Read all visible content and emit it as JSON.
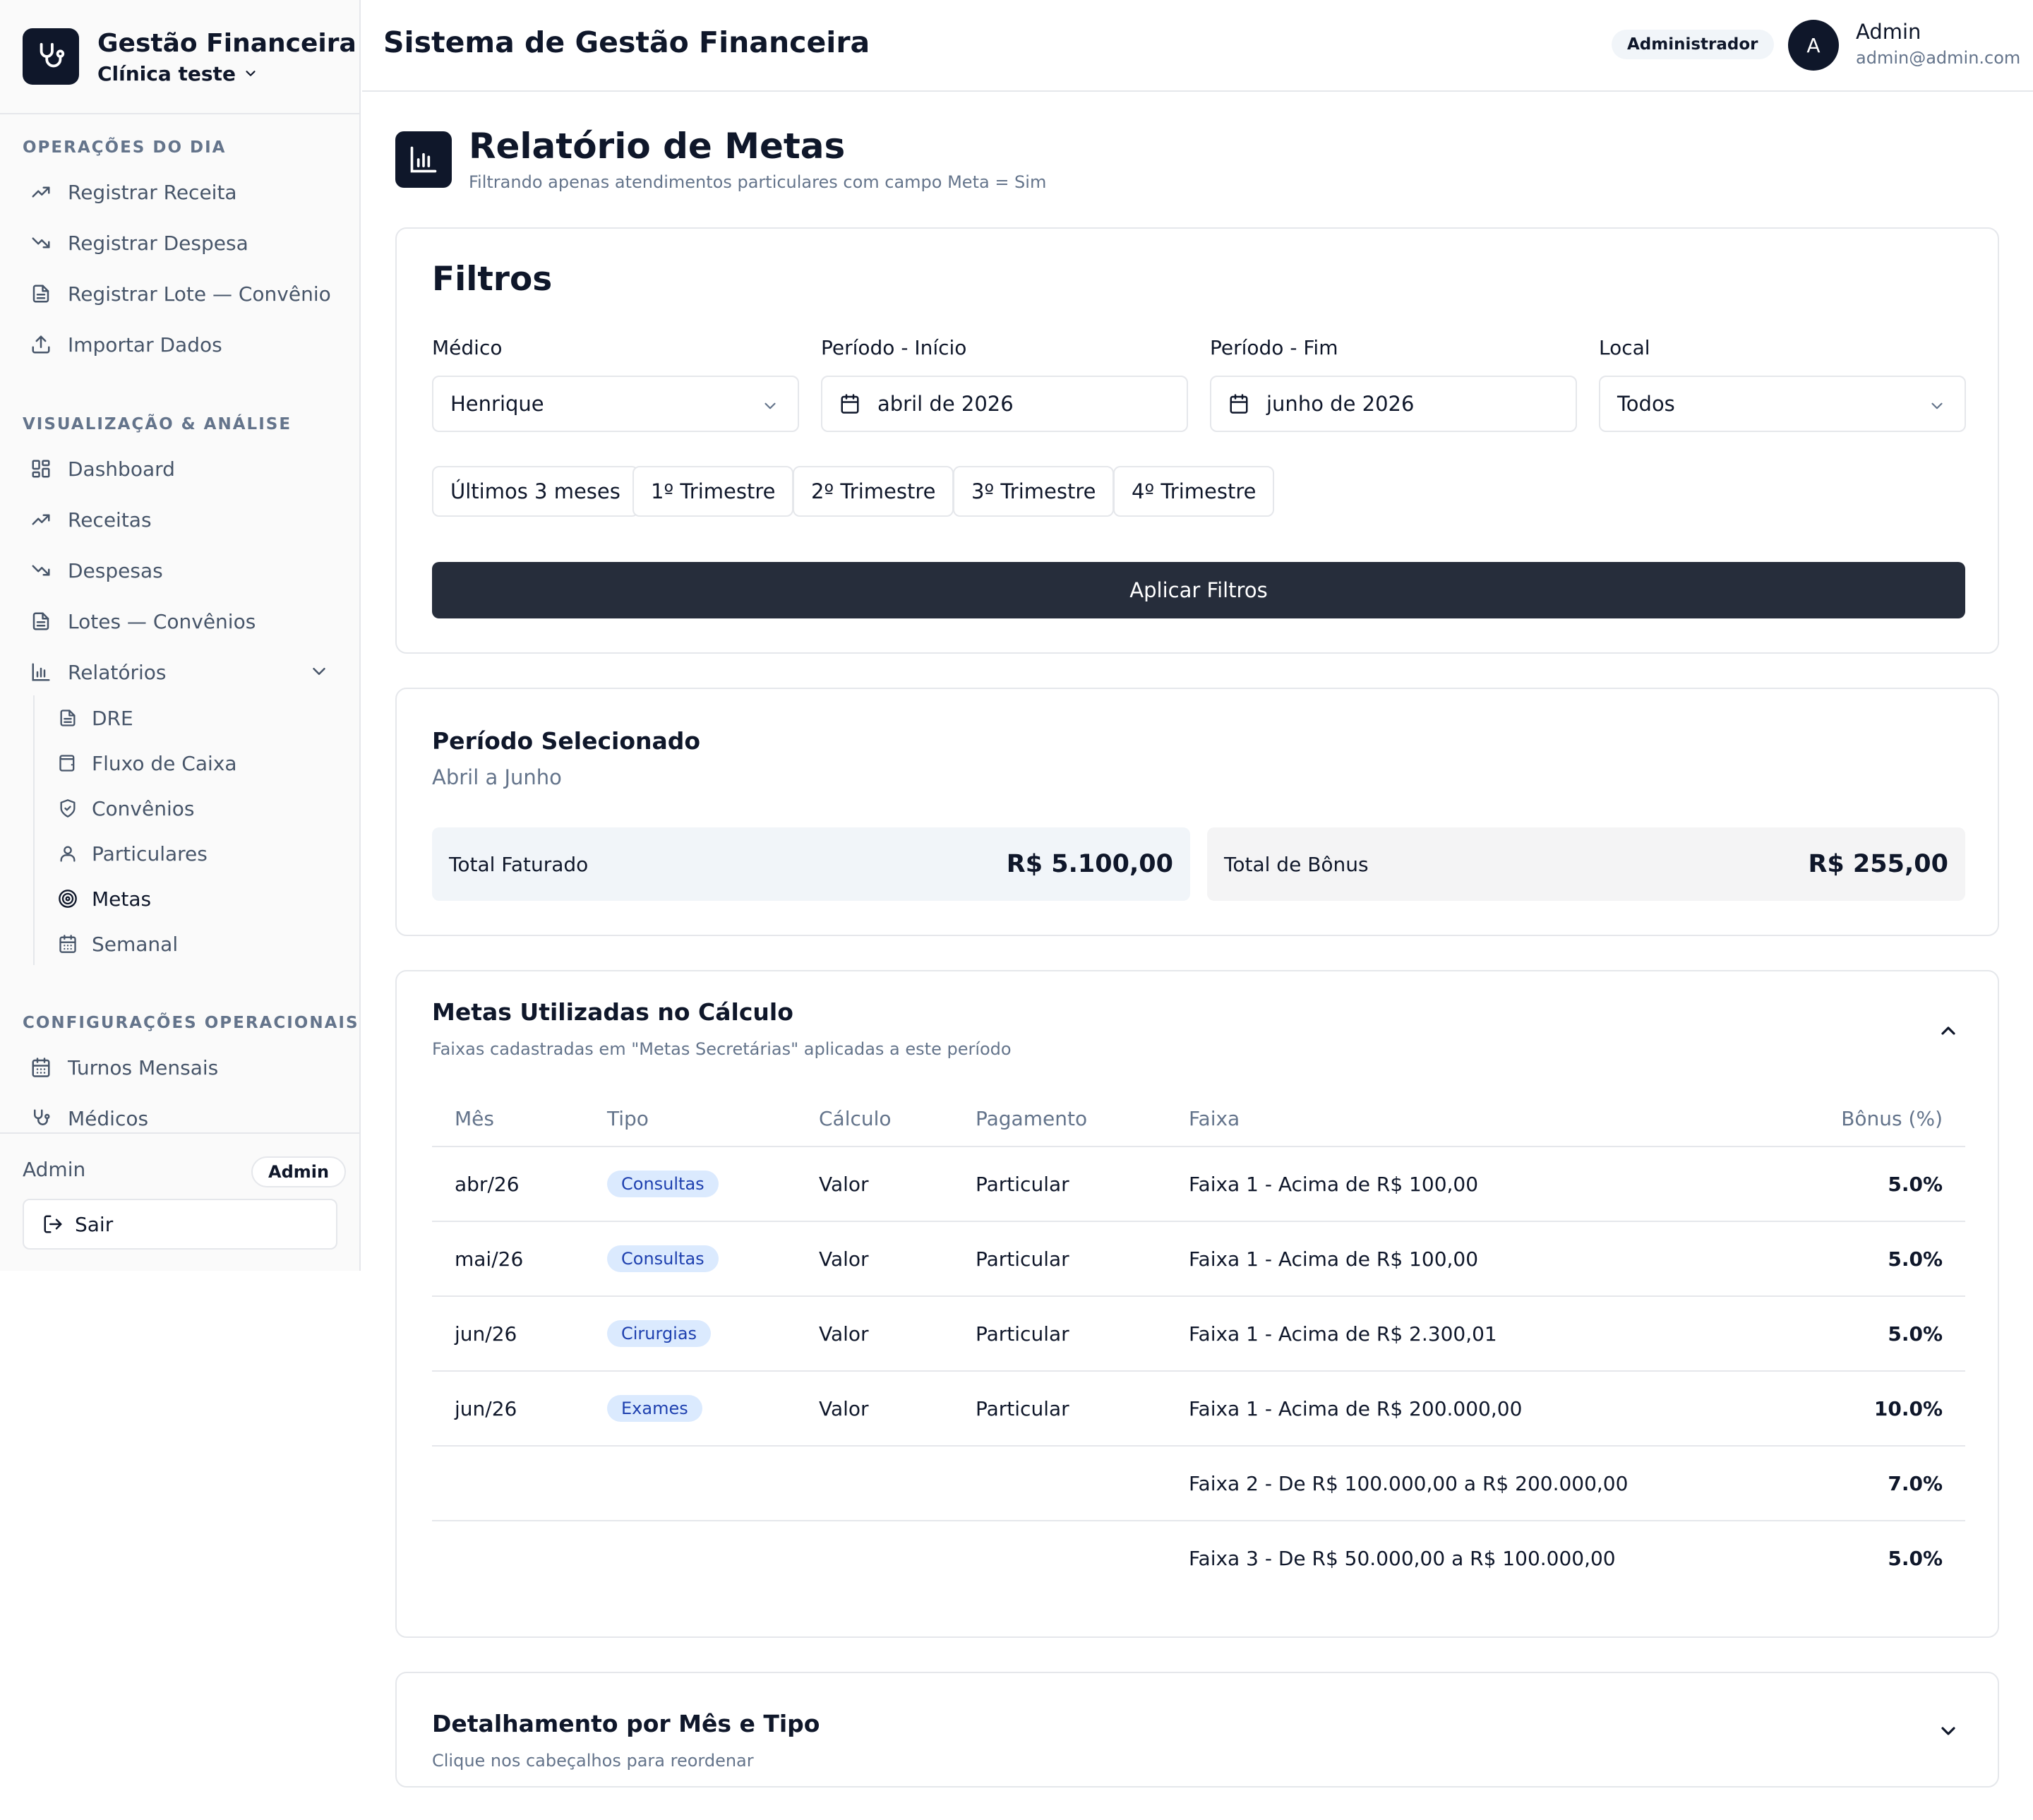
{
  "brand": {
    "title": "Gestão Financeira",
    "clinic": "Clínica teste"
  },
  "sidebar": {
    "section_ops": "OPERAÇÕES DO DIA",
    "ops_items": [
      {
        "label": "Registrar Receita",
        "icon": "trending-up-icon"
      },
      {
        "label": "Registrar Despesa",
        "icon": "trending-down-icon"
      },
      {
        "label": "Registrar Lote — Convênio",
        "icon": "document-icon"
      },
      {
        "label": "Importar Dados",
        "icon": "upload-icon"
      }
    ],
    "section_viz": "VISUALIZAÇÃO & ANÁLISE",
    "viz_items": [
      {
        "label": "Dashboard",
        "icon": "dashboard-icon"
      },
      {
        "label": "Receitas",
        "icon": "trending-up-icon"
      },
      {
        "label": "Despesas",
        "icon": "trending-down-icon"
      },
      {
        "label": "Lotes — Convênios",
        "icon": "document-icon"
      },
      {
        "label": "Relatórios",
        "icon": "bar-chart-icon"
      }
    ],
    "report_items": [
      {
        "label": "DRE",
        "icon": "document-icon"
      },
      {
        "label": "Fluxo de Caixa",
        "icon": "wallet-icon"
      },
      {
        "label": "Convênios",
        "icon": "shield-icon"
      },
      {
        "label": "Particulares",
        "icon": "user-icon"
      },
      {
        "label": "Metas",
        "icon": "target-icon"
      },
      {
        "label": "Semanal",
        "icon": "calendar-icon"
      }
    ],
    "section_config": "CONFIGURAÇÕES OPERACIONAIS",
    "config_items": [
      {
        "label": "Turnos Mensais",
        "icon": "calendar-icon"
      },
      {
        "label": "Médicos",
        "icon": "stethoscope-icon"
      }
    ],
    "footer": {
      "user": "Admin",
      "badge": "Admin",
      "logout": "Sair"
    }
  },
  "header": {
    "title": "Sistema de Gestão Financeira",
    "role": "Administrador",
    "avatar_initial": "A",
    "user_name": "Admin",
    "user_email": "admin@admin.com"
  },
  "page": {
    "title": "Relatório de Metas",
    "subtitle": "Filtrando apenas atendimentos particulares com campo Meta = Sim"
  },
  "filters": {
    "title": "Filtros",
    "medico_label": "Médico",
    "medico_value": "Henrique",
    "inicio_label": "Período - Início",
    "inicio_value": "abril de 2026",
    "fim_label": "Período - Fim",
    "fim_value": "junho de 2026",
    "local_label": "Local",
    "local_value": "Todos",
    "quick": [
      "Últimos 3 meses",
      "1º Trimestre",
      "2º Trimestre",
      "3º Trimestre",
      "4º Trimestre"
    ],
    "apply": "Aplicar Filtros"
  },
  "period": {
    "title": "Período Selecionado",
    "value": "Abril a Junho",
    "total_faturado_label": "Total Faturado",
    "total_faturado_value": "R$ 5.100,00",
    "total_bonus_label": "Total de Bônus",
    "total_bonus_value": "R$ 255,00"
  },
  "metas": {
    "title": "Metas Utilizadas no Cálculo",
    "subtitle": "Faixas cadastradas em \"Metas Secretárias\" aplicadas a este período",
    "columns": [
      "Mês",
      "Tipo",
      "Cálculo",
      "Pagamento",
      "Faixa",
      "Bônus (%)"
    ],
    "rows": [
      {
        "mes": "abr/26",
        "tipo": "Consultas",
        "calculo": "Valor",
        "pagamento": "Particular",
        "faixa": "Faixa 1 - Acima de R$ 100,00",
        "bonus": "5.0%"
      },
      {
        "mes": "mai/26",
        "tipo": "Consultas",
        "calculo": "Valor",
        "pagamento": "Particular",
        "faixa": "Faixa 1 - Acima de R$ 100,00",
        "bonus": "5.0%"
      },
      {
        "mes": "jun/26",
        "tipo": "Cirurgias",
        "calculo": "Valor",
        "pagamento": "Particular",
        "faixa": "Faixa 1 - Acima de R$ 2.300,01",
        "bonus": "5.0%"
      },
      {
        "mes": "jun/26",
        "tipo": "Exames",
        "calculo": "Valor",
        "pagamento": "Particular",
        "faixa": "Faixa 1 - Acima de R$ 200.000,00",
        "bonus": "10.0%"
      },
      {
        "mes": "",
        "tipo": "",
        "calculo": "",
        "pagamento": "",
        "faixa": "Faixa 2 - De R$ 100.000,00 a R$ 200.000,00",
        "bonus": "7.0%"
      },
      {
        "mes": "",
        "tipo": "",
        "calculo": "",
        "pagamento": "",
        "faixa": "Faixa 3 - De R$ 50.000,00 a R$ 100.000,00",
        "bonus": "5.0%"
      }
    ]
  },
  "detalhamento": {
    "title": "Detalhamento por Mês e Tipo",
    "subtitle": "Clique nos cabeçalhos para reordenar"
  },
  "colors": {
    "primary": "#0f172a",
    "button_dark": "#262d3b",
    "muted_text": "#64748b",
    "border": "#e5e7eb",
    "badge_bg": "#dbeafe",
    "badge_text": "#1e40af",
    "stat_faturado_bg": "#f1f5f9",
    "stat_bonus_bg": "#f4f4f5"
  }
}
